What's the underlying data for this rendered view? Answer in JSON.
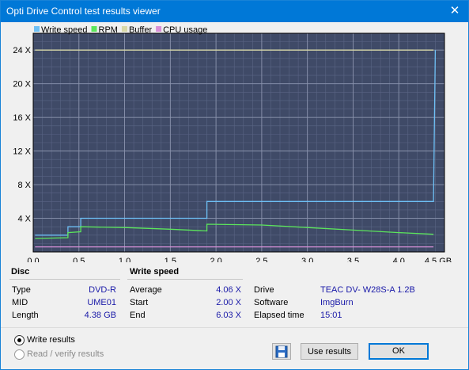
{
  "window": {
    "title": "Opti Drive Control test results viewer",
    "close_glyph": "✕"
  },
  "legend": [
    {
      "label": "Write speed",
      "color": "#6ec0f5"
    },
    {
      "label": "RPM",
      "color": "#5ce65c"
    },
    {
      "label": "Buffer",
      "color": "#d8d8a8"
    },
    {
      "label": "CPU usage",
      "color": "#d890d8"
    }
  ],
  "chart_data": {
    "type": "line",
    "xlabel_unit": "GB",
    "xlim": [
      0.0,
      4.5
    ],
    "ylim": [
      0,
      26
    ],
    "x_ticks": [
      "0.0",
      "0.5",
      "1.0",
      "1.5",
      "2.0",
      "2.5",
      "3.0",
      "3.5",
      "4.0",
      "4.5 GB"
    ],
    "x_tick_values": [
      0.0,
      0.5,
      1.0,
      1.5,
      2.0,
      2.5,
      3.0,
      3.5,
      4.0,
      4.5
    ],
    "y_ticks": [
      "4 X",
      "8 X",
      "12 X",
      "16 X",
      "20 X",
      "24 X"
    ],
    "y_tick_values": [
      4,
      8,
      12,
      16,
      20,
      24
    ],
    "grid": true,
    "series": [
      {
        "name": "Write speed",
        "color": "#6ec0f5",
        "x": [
          0.02,
          0.38,
          0.38,
          0.52,
          0.52,
          1.9,
          1.9,
          4.38,
          4.4
        ],
        "y": [
          2.0,
          2.0,
          3.0,
          3.0,
          4.0,
          4.0,
          6.0,
          6.0,
          24.0
        ]
      },
      {
        "name": "RPM",
        "color": "#5ce65c",
        "x": [
          0.02,
          0.38,
          0.38,
          0.52,
          0.52,
          1.0,
          1.5,
          1.9,
          1.9,
          2.5,
          3.0,
          3.5,
          4.0,
          4.38
        ],
        "y": [
          1.6,
          1.7,
          2.3,
          2.4,
          3.0,
          2.9,
          2.7,
          2.5,
          3.3,
          3.2,
          2.9,
          2.6,
          2.3,
          2.1
        ]
      },
      {
        "name": "Buffer",
        "color": "#d8d8a8",
        "x": [
          0.02,
          4.38
        ],
        "y": [
          24.0,
          24.0
        ]
      },
      {
        "name": "CPU usage",
        "color": "#d890d8",
        "x": [
          0.02,
          4.38
        ],
        "y": [
          0.6,
          0.6
        ]
      }
    ]
  },
  "disc": {
    "header": "Disc",
    "rows": [
      {
        "label": "Type",
        "value": "DVD-R"
      },
      {
        "label": "MID",
        "value": "UME01"
      },
      {
        "label": "Length",
        "value": "4.38 GB"
      }
    ]
  },
  "write_speed": {
    "header": "Write speed",
    "rows": [
      {
        "label": "Average",
        "value": "4.06 X"
      },
      {
        "label": "Start",
        "value": "2.00 X"
      },
      {
        "label": "End",
        "value": "6.03 X"
      }
    ]
  },
  "info": {
    "rows": [
      {
        "label": "Drive",
        "value": "TEAC DV- W28S-A 1.2B"
      },
      {
        "label": "Software",
        "value": "ImgBurn"
      },
      {
        "label": "Elapsed time",
        "value": "15:01"
      }
    ]
  },
  "options": {
    "write_results": "Write results",
    "read_verify_results": "Read / verify results",
    "selected": "write_results"
  },
  "buttons": {
    "use_results": "Use results",
    "ok": "OK",
    "save_icon": "save-icon"
  }
}
